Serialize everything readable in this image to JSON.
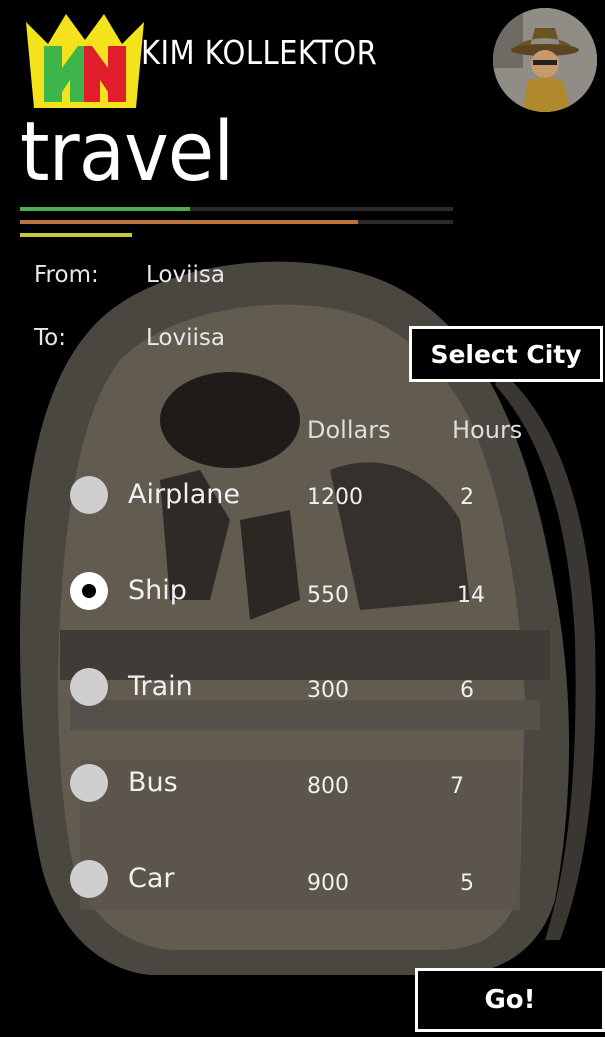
{
  "header": {
    "app_title": "KIM KOLLEKTOR",
    "logo_letters": "KK",
    "page_title": "travel"
  },
  "route": {
    "from_label": "From:",
    "from_value": "Loviisa",
    "to_label": "To:",
    "to_value": "Loviisa",
    "select_city_label": "Select City"
  },
  "table": {
    "col_dollars": "Dollars",
    "col_hours": "Hours",
    "rows": [
      {
        "mode": "Airplane",
        "dollars": "1200",
        "hours": "2",
        "selected": false
      },
      {
        "mode": "Ship",
        "dollars": "550",
        "hours": "14",
        "selected": true
      },
      {
        "mode": "Train",
        "dollars": "300",
        "hours": "6",
        "selected": false
      },
      {
        "mode": "Bus",
        "dollars": "800",
        "hours": "7",
        "selected": false
      },
      {
        "mode": "Car",
        "dollars": "900",
        "hours": "5",
        "selected": false
      }
    ]
  },
  "go_label": "Go!",
  "colors": {
    "bar_green": "#4caf50",
    "bar_orange": "#b8743a",
    "bar_yellow": "#c9c83a",
    "bar_track": "#2a2a2a",
    "logo_yellow": "#f3e21c",
    "logo_red": "#e21d2b",
    "logo_green": "#3db54a"
  },
  "icons": [
    "crown-logo-icon",
    "avatar-detective-icon",
    "radio-icon"
  ]
}
